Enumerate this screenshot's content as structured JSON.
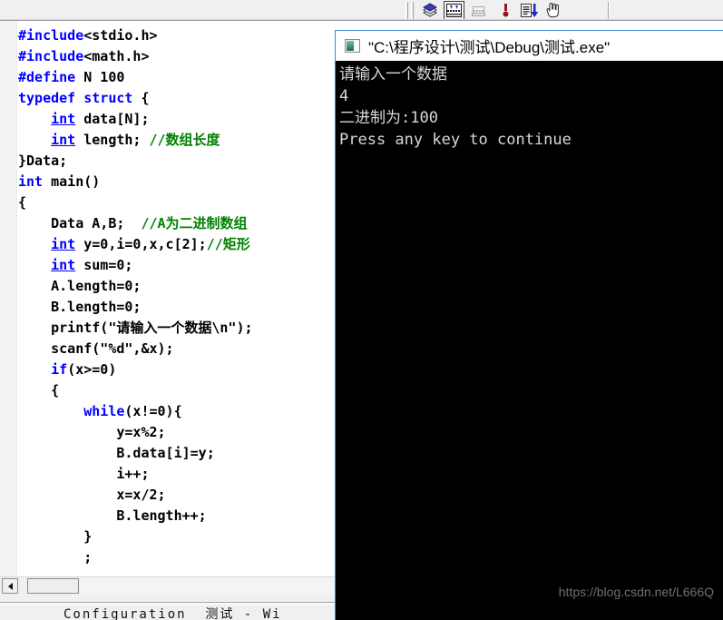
{
  "toolbar": {
    "buttons": [
      {
        "name": "compile-icon",
        "label": "Compile",
        "pressed": false
      },
      {
        "name": "build-icon",
        "label": "Build",
        "pressed": true
      },
      {
        "name": "build-disabled-icon",
        "label": "Stop Build",
        "pressed": false
      },
      {
        "name": "breakpoint-icon",
        "label": "Insert Breakpoint",
        "pressed": false
      },
      {
        "name": "execute-icon",
        "label": "Execute Program",
        "pressed": false
      },
      {
        "name": "pointer-hand-icon",
        "label": "Go To",
        "pressed": false
      }
    ]
  },
  "editor": {
    "lines": [
      [
        {
          "t": "#include",
          "c": "kw"
        },
        {
          "t": "<stdio.h>",
          "c": ""
        }
      ],
      [
        {
          "t": "#include",
          "c": "kw"
        },
        {
          "t": "<math.h>",
          "c": ""
        }
      ],
      [
        {
          "t": "#define",
          "c": "kw"
        },
        {
          "t": " N 100",
          "c": ""
        }
      ],
      [
        {
          "t": "typedef struct",
          "c": "kw"
        },
        {
          "t": " {",
          "c": ""
        }
      ],
      [
        {
          "t": "    ",
          "c": ""
        },
        {
          "t": "int",
          "c": "kwu"
        },
        {
          "t": " data[N];",
          "c": ""
        }
      ],
      [
        {
          "t": "    ",
          "c": ""
        },
        {
          "t": "int",
          "c": "kwu"
        },
        {
          "t": " length; ",
          "c": ""
        },
        {
          "t": "//数组长度",
          "c": "cmt"
        }
      ],
      [
        {
          "t": "}Data;",
          "c": ""
        }
      ],
      [
        {
          "t": "int",
          "c": "kw"
        },
        {
          "t": " main()",
          "c": ""
        }
      ],
      [
        {
          "t": "{",
          "c": ""
        }
      ],
      [
        {
          "t": "    Data A,B;  ",
          "c": ""
        },
        {
          "t": "//A为二进制数组",
          "c": "cmt"
        }
      ],
      [
        {
          "t": "    ",
          "c": ""
        },
        {
          "t": "int",
          "c": "kwu"
        },
        {
          "t": " y=0,i=0,x,c[2];",
          "c": ""
        },
        {
          "t": "//矩形",
          "c": "cmt"
        }
      ],
      [
        {
          "t": "    ",
          "c": ""
        },
        {
          "t": "int",
          "c": "kwu"
        },
        {
          "t": " sum=0;",
          "c": ""
        }
      ],
      [
        {
          "t": "    A.length=0;",
          "c": ""
        }
      ],
      [
        {
          "t": "    B.length=0;",
          "c": ""
        }
      ],
      [
        {
          "t": "    printf(\"请输入一个数据\\n\");",
          "c": ""
        }
      ],
      [
        {
          "t": "    scanf(\"%d\",&x);",
          "c": ""
        }
      ],
      [
        {
          "t": "    ",
          "c": ""
        },
        {
          "t": "if",
          "c": "kw"
        },
        {
          "t": "(x>=0)",
          "c": ""
        }
      ],
      [
        {
          "t": "    {",
          "c": ""
        }
      ],
      [
        {
          "t": "        ",
          "c": ""
        },
        {
          "t": "while",
          "c": "kw"
        },
        {
          "t": "(x!=0){",
          "c": ""
        }
      ],
      [
        {
          "t": "            y=x%2;",
          "c": ""
        }
      ],
      [
        {
          "t": "            B.data[i]=y;",
          "c": ""
        }
      ],
      [
        {
          "t": "            i++;",
          "c": ""
        }
      ],
      [
        {
          "t": "            x=x/2;",
          "c": ""
        }
      ],
      [
        {
          "t": "            B.length++;",
          "c": ""
        }
      ],
      [
        {
          "t": "        }",
          "c": ""
        }
      ],
      [
        {
          "t": "        ;",
          "c": ""
        }
      ]
    ]
  },
  "bottom_panel": {
    "text": "Configuration  测试 - Wi"
  },
  "console": {
    "title": "\"C:\\程序设计\\测试\\Debug\\测试.exe\"",
    "icon_name": "console-window-icon",
    "output_lines": [
      "请输入一个数据",
      "4",
      "二进制为:100",
      "Press any key to continue"
    ],
    "watermark": "https://blog.csdn.net/L666Q"
  },
  "colors": {
    "keyword": "#0000ff",
    "comment": "#008000",
    "console_bg": "#000000",
    "console_fg": "#d8d8d8",
    "window_border": "#3e86d1"
  }
}
